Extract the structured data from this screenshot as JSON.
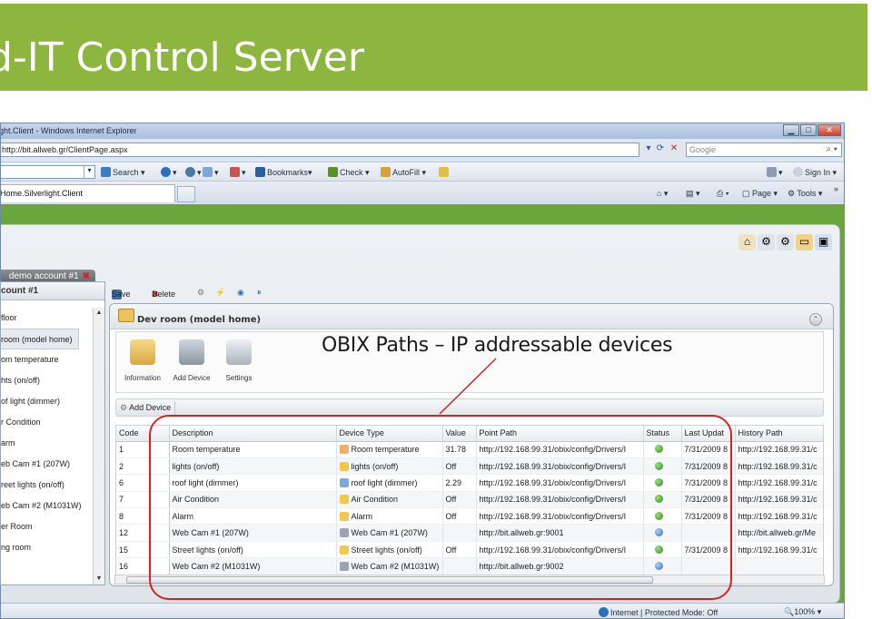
{
  "slide": {
    "title": "d-IT Control Server"
  },
  "browser": {
    "window_title": "ght.Client - Windows Internet Explorer",
    "url": "http://bit.allweb.gr/ClientPage.aspx",
    "search_placeholder": "Google",
    "toolbar": {
      "search": "Search",
      "bookmarks": "Bookmarks",
      "check": "Check",
      "autofill": "AutoFill",
      "sign_in": "Sign In"
    },
    "tab_title": "Home.Silverlight.Client",
    "commands": {
      "page": "Page",
      "tools": "Tools"
    },
    "status": {
      "zone": "Internet | Protected Mode: Off",
      "zoom": "100%"
    }
  },
  "app": {
    "account_tab": {
      "prefix": "t",
      "label": "demo account #1"
    },
    "left_panel": {
      "title": "count #1",
      "items": [
        "floor",
        "room (model home)",
        "om temperature",
        "hts (on/off)",
        "of light (dimmer)",
        "r Condition",
        "arm",
        "eb Cam #1 (207W)",
        "reet lights (on/off)",
        "eb Cam #2 (M1031W)",
        "er Room",
        "ng room"
      ],
      "selected_index": 1
    },
    "main_toolbar": {
      "save": "Save",
      "delete": "Delete"
    },
    "panel_title": "Dev room (model home)",
    "ribbon": {
      "information": "Information",
      "add_device": "Add Device",
      "settings": "Settings"
    },
    "sub_toolbar": {
      "add_device": "Add Device"
    },
    "grid": {
      "columns": [
        "Code",
        "Description",
        "Device Type",
        "Value",
        "Point Path",
        "Status",
        "Last Updat",
        "History Path"
      ],
      "rows": [
        {
          "code": "1",
          "description": "Room temperature",
          "device_type": "Room temperature",
          "value": "31.78",
          "point_path": "http://192.168.99.31/obix/config/Drivers/I",
          "status": "ok",
          "last_update": "7/31/2009 8",
          "history_path": "http://192.168.99.31/c"
        },
        {
          "code": "2",
          "description": "lights (on/off)",
          "device_type": "lights (on/off)",
          "value": "Off",
          "point_path": "http://192.168.99.31/obix/config/Drivers/I",
          "status": "ok",
          "last_update": "7/31/2009 8",
          "history_path": "http://192.168.99.31/c"
        },
        {
          "code": "6",
          "description": "roof light (dimmer)",
          "device_type": "roof light (dimmer)",
          "value": "2.29",
          "point_path": "http://192.168.99.31/obix/config/Drivers/I",
          "status": "ok",
          "last_update": "7/31/2009 8",
          "history_path": "http://192.168.99.31/c"
        },
        {
          "code": "7",
          "description": "Air Condition",
          "device_type": "Air Condition",
          "value": "Off",
          "point_path": "http://192.168.99.31/obix/config/Drivers/I",
          "status": "ok",
          "last_update": "7/31/2009 8",
          "history_path": "http://192.168.99.31/c"
        },
        {
          "code": "8",
          "description": "Alarm",
          "device_type": "Alarm",
          "value": "Off",
          "point_path": "http://192.168.99.31/obix/config/Drivers/I",
          "status": "ok",
          "last_update": "7/31/2009 8",
          "history_path": "http://192.168.99.31/c"
        },
        {
          "code": "12",
          "description": "Web Cam #1 (207W)",
          "device_type": "Web Cam #1 (207W)",
          "value": "",
          "point_path": "http://bit.allweb.gr:9001",
          "status": "unknown",
          "last_update": "",
          "history_path": "http://bit.allweb.gr/Me"
        },
        {
          "code": "15",
          "description": "Street lights (on/off)",
          "device_type": "Street lights (on/off)",
          "value": "Off",
          "point_path": "http://192.168.99.31/obix/config/Drivers/I",
          "status": "ok",
          "last_update": "7/31/2009 8",
          "history_path": "http://192.168.99.31/c"
        },
        {
          "code": "16",
          "description": "Web Cam #2 (M1031W)",
          "device_type": "Web Cam #2 (M1031W)",
          "value": "",
          "point_path": "http://bit.allweb.gr:9002",
          "status": "unknown",
          "last_update": "",
          "history_path": ""
        }
      ]
    }
  },
  "annotation": {
    "text": "OBIX Paths – IP addressable devices"
  },
  "colors": {
    "slide_green": "#8db63e",
    "app_green": "#6aa63b",
    "annotation_red": "#d32424"
  }
}
